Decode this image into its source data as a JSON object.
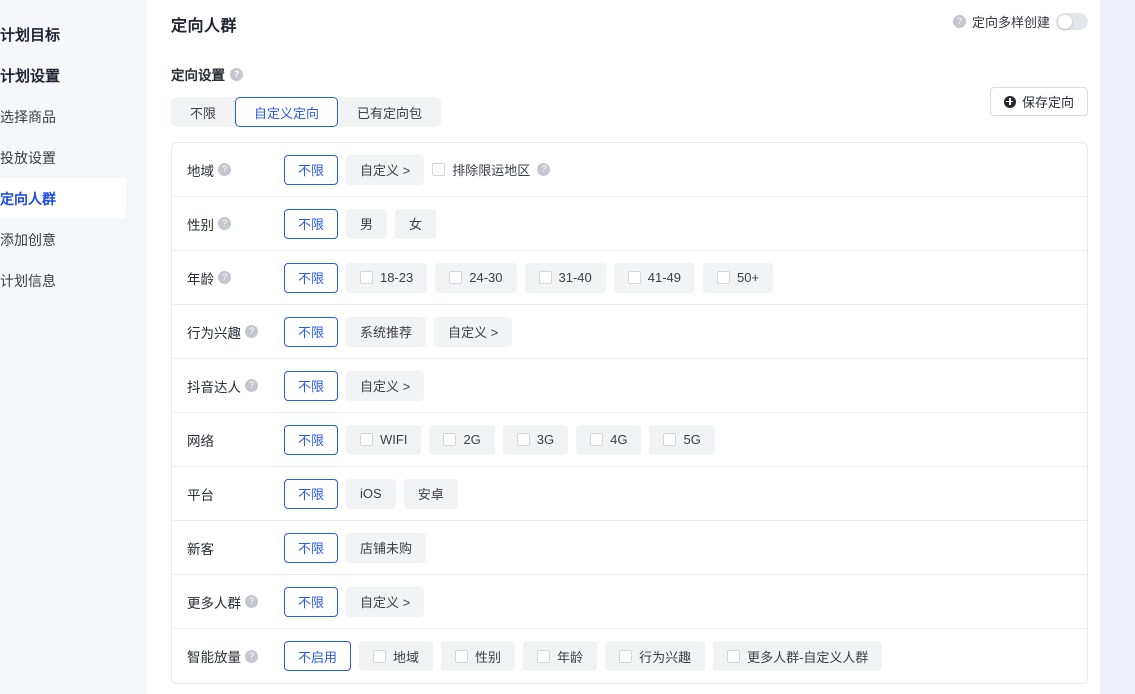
{
  "sidebar": {
    "items": [
      {
        "label": "计划目标",
        "type": "group",
        "active": false
      },
      {
        "label": "计划设置",
        "type": "group",
        "active": false
      },
      {
        "label": "选择商品",
        "type": "item",
        "active": false
      },
      {
        "label": "投放设置",
        "type": "item",
        "active": false
      },
      {
        "label": "定向人群",
        "type": "item",
        "active": true
      },
      {
        "label": "添加创意",
        "type": "item",
        "active": false
      },
      {
        "label": "计划信息",
        "type": "item",
        "active": false
      }
    ]
  },
  "header": {
    "title": "定向人群",
    "diverse_create_label": "定向多样创建",
    "diverse_create_on": false,
    "help_icon": "question-mark-icon",
    "toggle_icon": "toggle-switch-icon"
  },
  "section": {
    "label": "定向设置",
    "tabs": [
      {
        "label": "不限",
        "selected": false
      },
      {
        "label": "自定义定向",
        "selected": true
      },
      {
        "label": "已有定向包",
        "selected": false
      }
    ],
    "save_button": {
      "label": "保存定向",
      "icon": "plus-circle-icon"
    }
  },
  "colors": {
    "accent": "#2a5bf0",
    "sidebar_bg": "#f6f7fb",
    "chip_bg": "#f2f3f5",
    "border": "#e8eaed",
    "right_strip": "#eef1fb"
  },
  "rows": [
    {
      "label": "地域",
      "help": true,
      "options": [
        {
          "label": "不限",
          "primary": true,
          "checkbox": false
        },
        {
          "label": "自定义 >",
          "primary": false,
          "checkbox": false
        }
      ],
      "extra_check": {
        "label": "排除限运地区",
        "help": true,
        "checked": false
      }
    },
    {
      "label": "性别",
      "help": true,
      "options": [
        {
          "label": "不限",
          "primary": true,
          "checkbox": false
        },
        {
          "label": "男",
          "primary": false,
          "checkbox": false
        },
        {
          "label": "女",
          "primary": false,
          "checkbox": false
        }
      ]
    },
    {
      "label": "年龄",
      "help": true,
      "options": [
        {
          "label": "不限",
          "primary": true,
          "checkbox": false
        },
        {
          "label": "18-23",
          "primary": false,
          "checkbox": true,
          "checked": false
        },
        {
          "label": "24-30",
          "primary": false,
          "checkbox": true,
          "checked": false
        },
        {
          "label": "31-40",
          "primary": false,
          "checkbox": true,
          "checked": false
        },
        {
          "label": "41-49",
          "primary": false,
          "checkbox": true,
          "checked": false
        },
        {
          "label": "50+",
          "primary": false,
          "checkbox": true,
          "checked": false
        }
      ]
    },
    {
      "label": "行为兴趣",
      "help": true,
      "options": [
        {
          "label": "不限",
          "primary": true,
          "checkbox": false
        },
        {
          "label": "系统推荐",
          "primary": false,
          "checkbox": false
        },
        {
          "label": "自定义 >",
          "primary": false,
          "checkbox": false
        }
      ]
    },
    {
      "label": "抖音达人",
      "help": true,
      "options": [
        {
          "label": "不限",
          "primary": true,
          "checkbox": false
        },
        {
          "label": "自定义 >",
          "primary": false,
          "checkbox": false
        }
      ]
    },
    {
      "label": "网络",
      "help": false,
      "options": [
        {
          "label": "不限",
          "primary": true,
          "checkbox": false
        },
        {
          "label": "WIFI",
          "primary": false,
          "checkbox": true,
          "checked": false
        },
        {
          "label": "2G",
          "primary": false,
          "checkbox": true,
          "checked": false
        },
        {
          "label": "3G",
          "primary": false,
          "checkbox": true,
          "checked": false
        },
        {
          "label": "4G",
          "primary": false,
          "checkbox": true,
          "checked": false
        },
        {
          "label": "5G",
          "primary": false,
          "checkbox": true,
          "checked": false
        }
      ]
    },
    {
      "label": "平台",
      "help": false,
      "options": [
        {
          "label": "不限",
          "primary": true,
          "checkbox": false
        },
        {
          "label": "iOS",
          "primary": false,
          "checkbox": false
        },
        {
          "label": "安卓",
          "primary": false,
          "checkbox": false
        }
      ]
    },
    {
      "label": "新客",
      "help": false,
      "options": [
        {
          "label": "不限",
          "primary": true,
          "checkbox": false
        },
        {
          "label": "店铺未购",
          "primary": false,
          "checkbox": false
        }
      ]
    },
    {
      "label": "更多人群",
      "help": true,
      "options": [
        {
          "label": "不限",
          "primary": true,
          "checkbox": false
        },
        {
          "label": "自定义 >",
          "primary": false,
          "checkbox": false
        }
      ]
    },
    {
      "label": "智能放量",
      "help": true,
      "options": [
        {
          "label": "不启用",
          "primary": true,
          "checkbox": false
        },
        {
          "label": "地域",
          "primary": false,
          "checkbox": true,
          "checked": false
        },
        {
          "label": "性别",
          "primary": false,
          "checkbox": true,
          "checked": false
        },
        {
          "label": "年龄",
          "primary": false,
          "checkbox": true,
          "checked": false
        },
        {
          "label": "行为兴趣",
          "primary": false,
          "checkbox": true,
          "checked": false
        },
        {
          "label": "更多人群-自定义人群",
          "primary": false,
          "checkbox": true,
          "checked": false
        }
      ]
    }
  ]
}
